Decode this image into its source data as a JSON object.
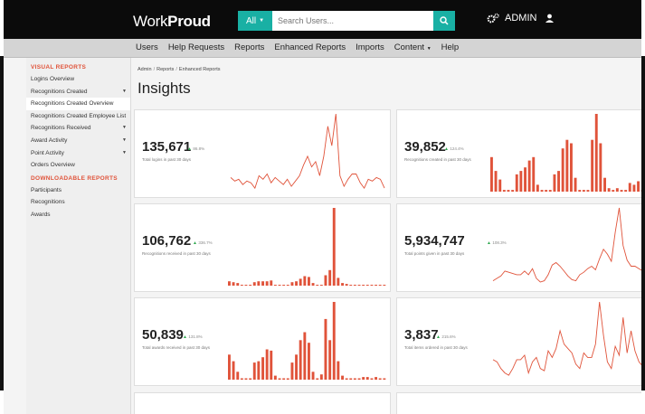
{
  "app": {
    "logo_prefix": "Work",
    "logo_bold": "Proud",
    "search": {
      "scope": "All",
      "placeholder": "Search Users..."
    },
    "admin_label": "ADMIN"
  },
  "nav": {
    "items": [
      "Users",
      "Help Requests",
      "Reports",
      "Enhanced Reports",
      "Imports",
      "Content",
      "Help"
    ]
  },
  "sidebar": {
    "visual_heading": "VISUAL REPORTS",
    "visual_items": [
      {
        "label": "Logins Overview"
      },
      {
        "label": "Recognitions Created",
        "caret": true
      },
      {
        "label": "Recognitions Created Overview",
        "active": true
      },
      {
        "label": "Recognitions Created Employee List"
      },
      {
        "label": "Recognitions Received",
        "caret": true
      },
      {
        "label": "Award Activity",
        "caret": true
      },
      {
        "label": "Point Activity",
        "caret": true
      },
      {
        "label": "Orders Overview"
      }
    ],
    "download_heading": "DOWNLOADABLE REPORTS",
    "download_items": [
      {
        "label": "Participants"
      },
      {
        "label": "Recognitions"
      },
      {
        "label": "Awards"
      }
    ]
  },
  "breadcrumb": {
    "admin": "Admin",
    "reports": "Reports",
    "current": "Enhanced Reports"
  },
  "page_title": "Insights",
  "accent_color": "#e0533a",
  "teal_color": "#19b0a4",
  "cards": [
    {
      "value": "135,671",
      "delta": "86.8%",
      "label": "Total logins in past 30 days",
      "chart": "line",
      "points": [
        8,
        6,
        7,
        4,
        6,
        5,
        2,
        9,
        7,
        10,
        5,
        8,
        6,
        4,
        7,
        3,
        6,
        9,
        15,
        20,
        14,
        17,
        9,
        20,
        37,
        26,
        44,
        9,
        3,
        7,
        10,
        10,
        5,
        2,
        7,
        6,
        8,
        7,
        2
      ]
    },
    {
      "value": "39,852",
      "delta": "124.4%",
      "label": "Recognitions created in past 30 days",
      "chart": "bar",
      "points": [
        20,
        12,
        7,
        1,
        1,
        1,
        10,
        12,
        14,
        18,
        20,
        4,
        1,
        1,
        1,
        10,
        12,
        25,
        30,
        28,
        8,
        1,
        1,
        1,
        30,
        45,
        28,
        8,
        2,
        1,
        2,
        1,
        1,
        5,
        4,
        6,
        1,
        1
      ]
    },
    {
      "value": "106,762",
      "delta": "336.7%",
      "label": "Recognitions received in past 30 days",
      "chart": "bar",
      "points": [
        5,
        4,
        3,
        1,
        1,
        1,
        4,
        5,
        5,
        5,
        6,
        1,
        1,
        1,
        1,
        4,
        5,
        8,
        11,
        10,
        3,
        1,
        1,
        12,
        18,
        90,
        9,
        3,
        2,
        1,
        1,
        1,
        1,
        1,
        1,
        1,
        1,
        1
      ]
    },
    {
      "value": "5,934,747",
      "delta": "108.3%",
      "label": "Total points given in past 30 days",
      "chart": "line",
      "points": [
        4,
        6,
        8,
        12,
        11,
        10,
        9,
        9,
        12,
        9,
        14,
        6,
        3,
        4,
        9,
        17,
        19,
        16,
        12,
        8,
        5,
        4,
        9,
        11,
        14,
        16,
        13,
        22,
        30,
        26,
        20,
        44,
        64,
        33,
        21,
        16,
        16,
        14,
        12,
        10
      ]
    },
    {
      "value": "50,839",
      "delta": "131.8%",
      "label": "Total awards received in past 30 days",
      "chart": "bar",
      "points": [
        19,
        14,
        6,
        1,
        1,
        1,
        13,
        14,
        17,
        23,
        22,
        3,
        1,
        1,
        1,
        13,
        19,
        30,
        36,
        28,
        6,
        1,
        4,
        46,
        30,
        59,
        14,
        3,
        1,
        1,
        1,
        1,
        2,
        2,
        1,
        2,
        1,
        1
      ]
    },
    {
      "value": "3,837",
      "delta": "215.6%",
      "label": "Total items ordered in past 30 days",
      "chart": "line",
      "points": [
        9,
        8,
        5,
        3,
        2,
        5,
        9,
        9,
        11,
        3,
        8,
        10,
        5,
        4,
        13,
        10,
        14,
        22,
        16,
        14,
        12,
        7,
        5,
        12,
        10,
        10,
        16,
        35,
        20,
        8,
        5,
        15,
        11,
        28,
        12,
        22,
        13,
        8,
        6,
        14
      ]
    }
  ]
}
